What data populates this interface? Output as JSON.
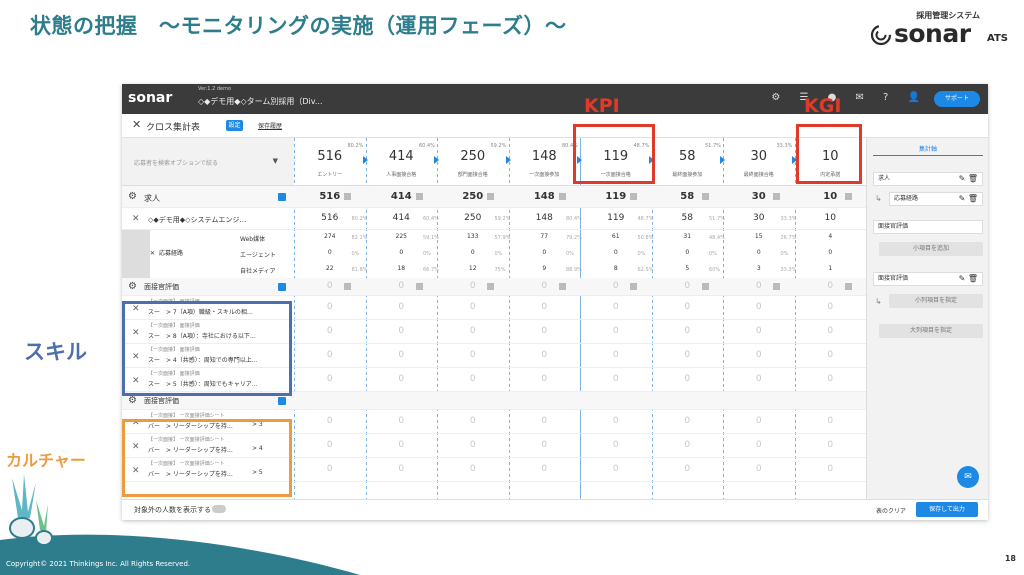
{
  "slide": {
    "title": "状態の把握　～モニタリングの実施（運用フェーズ）～",
    "brand": {
      "tagline": "採用管理システム",
      "name": "sonar",
      "suffix": "ATS"
    },
    "copyright": "Copyright© 2021 Thinkings Inc.  All Rights Reserved.",
    "page_number": "18",
    "annotations": {
      "kpi": "KPI",
      "kgi": "KGI",
      "skill": "スキル",
      "culture": "カルチャー"
    }
  },
  "app": {
    "header": {
      "logo": "sonar",
      "version": "Ver.1.2 demo",
      "breadcrumb": "◇◆デモ用◆◇ターム別採用（Div...",
      "support_label": "サポート"
    },
    "toolbar": {
      "title": "クロス集計表",
      "settings_label": "設定",
      "saved_label": "保存履歴"
    },
    "filter_placeholder": "応募者を検索オプションで絞る",
    "stages": [
      {
        "value": "516",
        "label": "エントリー",
        "rate": ""
      },
      {
        "value": "414",
        "label": "人事面接合格",
        "rate": "80.2%"
      },
      {
        "value": "250",
        "label": "部門面接合格",
        "rate": "60.4%"
      },
      {
        "value": "148",
        "label": "一次面接参加",
        "rate": "59.2%"
      },
      {
        "value": "119",
        "label": "一次面接合格",
        "rate": "80.4%"
      },
      {
        "value": "58",
        "label": "最終面接参加",
        "rate": "48.7%"
      },
      {
        "value": "30",
        "label": "最終面接合格",
        "rate": "51.7%"
      },
      {
        "value": "10",
        "label": "内定承諾",
        "rate": "33.3%"
      }
    ],
    "rows": {
      "job_section": {
        "label": "求人",
        "values": [
          "516",
          "414",
          "250",
          "148",
          "119",
          "58",
          "30",
          "10"
        ]
      },
      "job_item": {
        "label": "◇◆デモ用◆◇システムエンジ…",
        "values": [
          "516",
          "414",
          "250",
          "148",
          "119",
          "58",
          "30",
          "10"
        ],
        "rates": [
          "80.2%",
          "60.4%",
          "59.2%",
          "80.4%",
          "48.7%",
          "51.7%",
          "33.3%"
        ]
      },
      "route": {
        "label": "応募経路",
        "sub": [
          {
            "label": "Web媒体",
            "values": [
              "274",
              "225",
              "133",
              "77",
              "61",
              "31",
              "15",
              "4"
            ],
            "rates": [
              "82.1%",
              "59.1%",
              "57.9%",
              "79.2%",
              "50.8%",
              "48.4%",
              "26.7%"
            ]
          },
          {
            "label": "エージェント",
            "values": [
              "0",
              "0",
              "0",
              "0",
              "0",
              "0",
              "0",
              "0"
            ],
            "rates": [
              "0%",
              "0%",
              "0%",
              "0%",
              "0%",
              "0%",
              "0%"
            ]
          },
          {
            "label": "自社メディア",
            "values": [
              "22",
              "18",
              "12",
              "9",
              "8",
              "5",
              "3",
              "1"
            ],
            "rates": [
              "81.8%",
              "66.7%",
              "75%",
              "88.9%",
              "62.5%",
              "60%",
              "33.3%"
            ]
          }
        ]
      },
      "interviewer_section": {
        "label": "面接官評価"
      },
      "skill_items": [
        {
          "tag": "【一次面接】 面接評価",
          "label": "スー　> 7（A項）職級・スキルの相… "
        },
        {
          "tag": "【一次面接】 面接評価",
          "label": "スー　> 8（A項）：寺社における以下…"
        },
        {
          "tag": "【一次面接】 面接評価",
          "label": "スー　> 4（共感）：周知での専門以上…"
        },
        {
          "tag": "【一次面接】 面接評価",
          "label": "スー　> 5（共感）：周知でもキャリア…"
        }
      ],
      "interviewer2_section": {
        "label": "面接官評価"
      },
      "culture_items": [
        {
          "tag": "【一次面接】 一次面接評価シート",
          "label": "バー　> リーダーシップを持…",
          "value": "> 3"
        },
        {
          "tag": "【一次面接】 一次面接評価シート",
          "label": "バー　> リーダーシップを持…",
          "value": "> 4"
        },
        {
          "tag": "【一次面接】 一次面接評価シート",
          "label": "バー　> リーダーシップを持…",
          "value": "> 5"
        }
      ],
      "zero": "0"
    },
    "sidepanel": {
      "title": "集計軸",
      "boxes": [
        "求人",
        "応募経路",
        "面接官評価",
        "面接官評価"
      ],
      "btn_add_row": "小項目を追加",
      "btn_add_col": "小列項目を指定",
      "btn_add_big": "大列項目を指定"
    },
    "footer": {
      "toggle_label": "対象外の人数を表示する",
      "clear_label": "表のクリア",
      "export_label": "保存して出力"
    }
  }
}
